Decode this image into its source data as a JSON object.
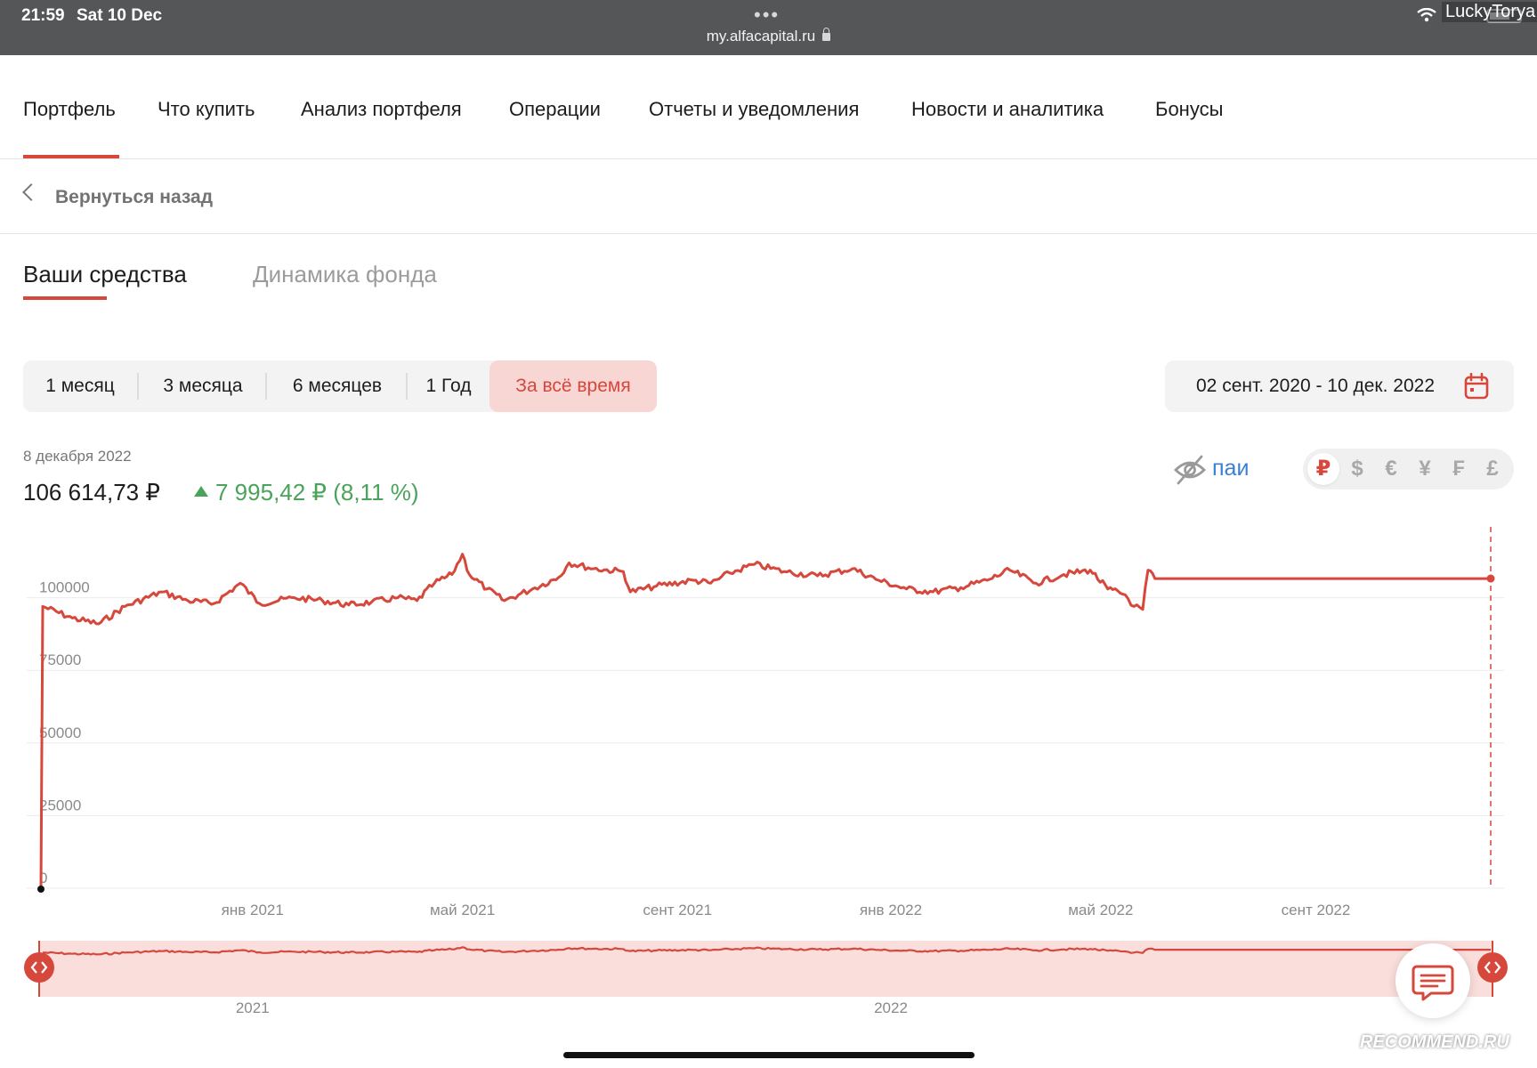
{
  "status_bar": {
    "time": "21:59",
    "date": "Sat 10 Dec",
    "url": "my.alfacapital.ru",
    "watermark_user": "LuckyTorya"
  },
  "nav": {
    "items": [
      {
        "label": "Портфель",
        "active": true
      },
      {
        "label": "Что купить"
      },
      {
        "label": "Анализ портфеля"
      },
      {
        "label": "Операции"
      },
      {
        "label": "Отчеты и уведомления"
      },
      {
        "label": "Новости и аналитика"
      },
      {
        "label": "Бонусы"
      }
    ]
  },
  "back": {
    "label": "Вернуться назад"
  },
  "tabs": [
    {
      "label": "Ваши средства",
      "active": true
    },
    {
      "label": "Динамика фонда"
    }
  ],
  "periods": [
    {
      "label": "1 месяц"
    },
    {
      "label": "3 месяца"
    },
    {
      "label": "6 месяцев"
    },
    {
      "label": "1 Год"
    },
    {
      "label": "За всё время",
      "active": true
    }
  ],
  "date_range": {
    "label": "02 сент. 2020 - 10 дек. 2022"
  },
  "summary": {
    "date": "8 декабря 2022",
    "value": "106 614,73 ₽",
    "change": "7 995,42 ₽ (8,11 %)"
  },
  "units_toggle": {
    "label": "паи",
    "icon": "eye-off-icon"
  },
  "currencies": [
    {
      "symbol": "₽",
      "active": true
    },
    {
      "symbol": "$"
    },
    {
      "symbol": "€"
    },
    {
      "symbol": "¥"
    },
    {
      "symbol": "₣"
    },
    {
      "symbol": "£"
    }
  ],
  "colors": {
    "accent": "#d6473c",
    "positive": "#4aa35a",
    "link": "#3b7fd1"
  },
  "chart_data": {
    "type": "line",
    "title": "",
    "xlabel": "",
    "ylabel": "",
    "ylim": [
      0,
      125000
    ],
    "y_ticks": [
      0,
      25000,
      50000,
      75000,
      100000
    ],
    "x_ticks": [
      "янв 2021",
      "май 2021",
      "сент 2021",
      "янв 2022",
      "май 2022",
      "сент 2022"
    ],
    "x_range": [
      "2020-09-02",
      "2022-12-10"
    ],
    "grid": true,
    "series": [
      {
        "points": [
          [
            "2020-09-02",
            0
          ],
          [
            "2020-09-03",
            97000
          ],
          [
            "2020-09-20",
            93000
          ],
          [
            "2020-10-05",
            91000
          ],
          [
            "2020-10-20",
            97000
          ],
          [
            "2020-11-10",
            102000
          ],
          [
            "2020-11-25",
            99000
          ],
          [
            "2020-12-10",
            98000
          ],
          [
            "2020-12-25",
            105000
          ],
          [
            "2021-01-05",
            98000
          ],
          [
            "2021-01-25",
            100000
          ],
          [
            "2021-02-10",
            99000
          ],
          [
            "2021-02-25",
            97500
          ],
          [
            "2021-03-10",
            98500
          ],
          [
            "2021-03-25",
            100000
          ],
          [
            "2021-04-05",
            99000
          ],
          [
            "2021-04-15",
            105000
          ],
          [
            "2021-04-25",
            108000
          ],
          [
            "2021-05-01",
            115000
          ],
          [
            "2021-05-05",
            108000
          ],
          [
            "2021-05-15",
            103000
          ],
          [
            "2021-05-25",
            99000
          ],
          [
            "2021-06-10",
            103000
          ],
          [
            "2021-06-25",
            107000
          ],
          [
            "2021-07-01",
            112000
          ],
          [
            "2021-07-15",
            110000
          ],
          [
            "2021-08-01",
            109000
          ],
          [
            "2021-08-05",
            102000
          ],
          [
            "2021-08-20",
            104000
          ],
          [
            "2021-09-10",
            106000
          ],
          [
            "2021-09-20",
            105000
          ],
          [
            "2021-10-01",
            108500
          ],
          [
            "2021-10-15",
            111500
          ],
          [
            "2021-11-01",
            109000
          ],
          [
            "2021-11-20",
            107500
          ],
          [
            "2021-12-10",
            110000
          ],
          [
            "2021-12-25",
            106000
          ],
          [
            "2022-01-10",
            103000
          ],
          [
            "2022-01-25",
            102000
          ],
          [
            "2022-02-10",
            103500
          ],
          [
            "2022-02-25",
            106000
          ],
          [
            "2022-03-10",
            109500
          ],
          [
            "2022-03-25",
            105000
          ],
          [
            "2022-04-10",
            108000
          ],
          [
            "2022-04-25",
            109500
          ],
          [
            "2022-05-05",
            103000
          ],
          [
            "2022-05-15",
            101000
          ],
          [
            "2022-05-20",
            97000
          ],
          [
            "2022-05-25",
            96000
          ],
          [
            "2022-05-28",
            109500
          ],
          [
            "2022-06-01",
            106600
          ],
          [
            "2022-12-10",
            106600
          ]
        ]
      }
    ],
    "navigator": {
      "x_ticks": [
        "2021",
        "2022"
      ]
    }
  }
}
